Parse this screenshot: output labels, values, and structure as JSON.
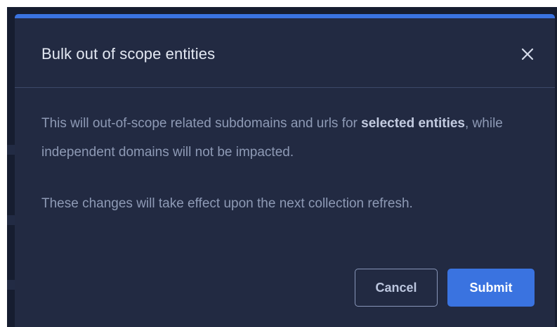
{
  "dialog": {
    "title": "Bulk out of scope entities",
    "close_icon": "close-icon",
    "message": {
      "part1": "This will out-of-scope related subdomains and urls for ",
      "bold": "selected entities",
      "part2": ", while independent domains will not be impacted."
    },
    "note": "These changes will take effect upon the next collection refresh.",
    "buttons": {
      "cancel_label": "Cancel",
      "submit_label": "Submit"
    }
  },
  "colors": {
    "accent": "#3a73e0",
    "modal_background": "#222a42",
    "backdrop": "#161d30"
  }
}
